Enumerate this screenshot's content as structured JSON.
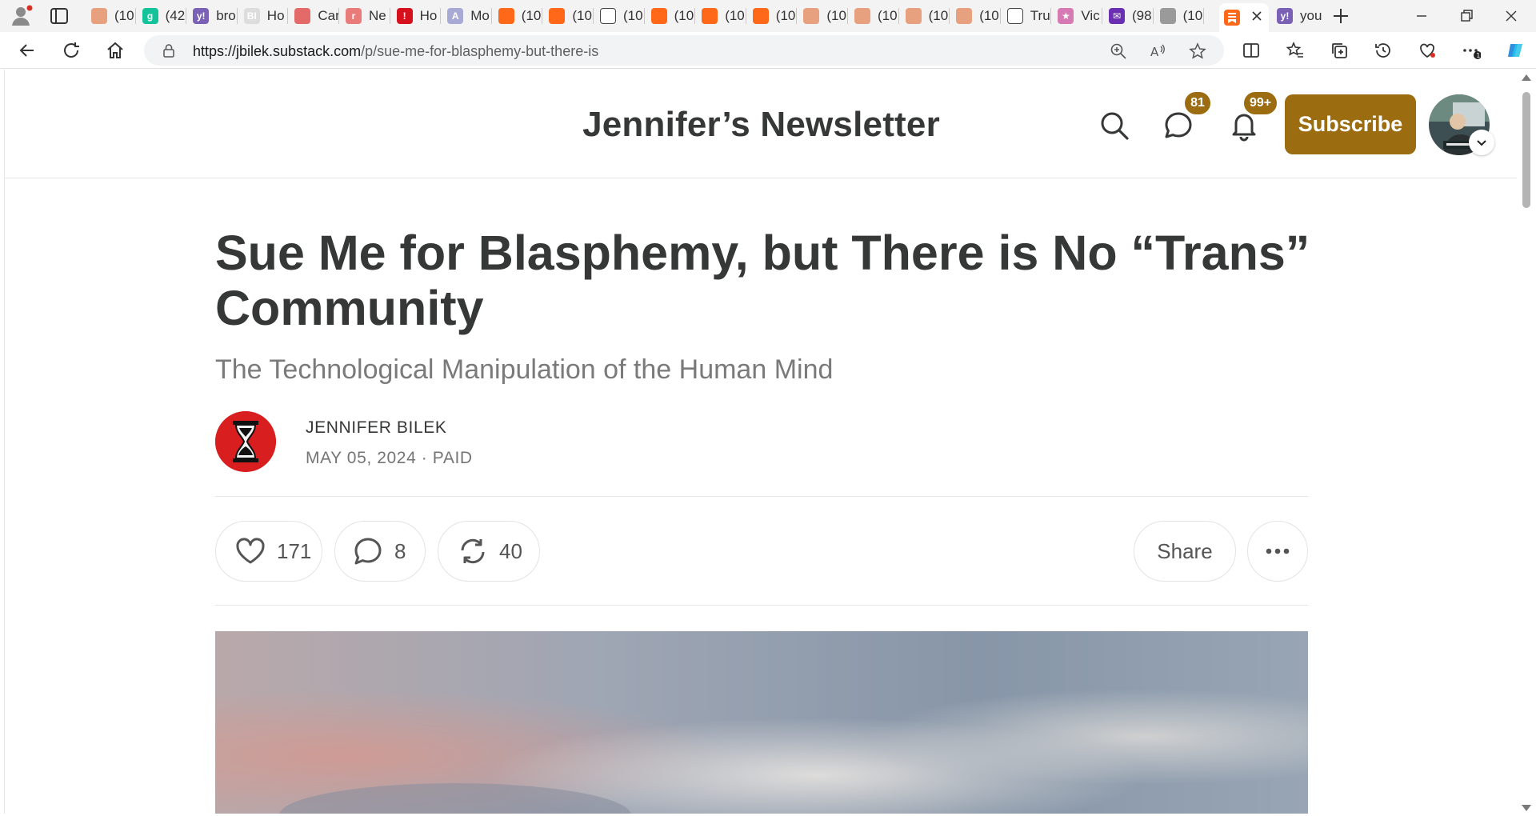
{
  "browser": {
    "tabs": [
      {
        "label": "(10",
        "color": "#e8a17f",
        "glyph": ""
      },
      {
        "label": "(42",
        "color": "#15c39a",
        "glyph": "g"
      },
      {
        "label": "bro",
        "color": "#7b61b6",
        "glyph": "y!"
      },
      {
        "label": "Ho",
        "color": "#dddddd",
        "glyph": "BI"
      },
      {
        "label": "Car",
        "color": "#e46a6a",
        "glyph": ""
      },
      {
        "label": "Ne",
        "color": "#e97b7b",
        "glyph": "r"
      },
      {
        "label": "Ho",
        "color": "#d6101d",
        "glyph": "!"
      },
      {
        "label": "Mo",
        "color": "#a9a9d6",
        "glyph": "A"
      },
      {
        "label": "(10",
        "color": "#ff6719",
        "glyph": ""
      },
      {
        "label": "(10",
        "color": "#ff6719",
        "glyph": ""
      },
      {
        "label": "(10",
        "color": "#ffffff",
        "glyph": ""
      },
      {
        "label": "(10",
        "color": "#ff6719",
        "glyph": ""
      },
      {
        "label": "(10",
        "color": "#ff6719",
        "glyph": ""
      },
      {
        "label": "(10",
        "color": "#ff6719",
        "glyph": ""
      },
      {
        "label": "(10",
        "color": "#e8a17f",
        "glyph": ""
      },
      {
        "label": "(10",
        "color": "#e8a17f",
        "glyph": ""
      },
      {
        "label": "(10",
        "color": "#e8a17f",
        "glyph": ""
      },
      {
        "label": "(10",
        "color": "#e8a17f",
        "glyph": ""
      },
      {
        "label": "Tru",
        "color": "#ffffff",
        "glyph": ""
      },
      {
        "label": "Vic",
        "color": "#d77ab3",
        "glyph": "★"
      },
      {
        "label": "(98",
        "color": "#6b2fb3",
        "glyph": "✉"
      },
      {
        "label": "(10",
        "color": "#9a9a9a",
        "glyph": ""
      }
    ],
    "active_tab": {
      "label": "",
      "color": "#ff6719"
    },
    "last_tab": {
      "label": "you",
      "color": "#7b61b6",
      "glyph": "y!"
    },
    "url_host": "https://jbilek.substack.com",
    "url_path": "/p/sue-me-for-blasphemy-but-there-is",
    "toolbar_badge": "1"
  },
  "site": {
    "publication_name": "Jennifer’s Newsletter",
    "chat_badge": "81",
    "notifications_badge": "99+",
    "subscribe_label": "Subscribe",
    "accent_color": "#9b6d10"
  },
  "post": {
    "title": "Sue Me for Blasphemy, but There is No “Trans” Community",
    "subtitle": "The Technological Manipulation of the Human Mind",
    "author": "JENNIFER BILEK",
    "meta": "MAY 05, 2024 · PAID",
    "likes": "171",
    "comments": "8",
    "restacks": "40",
    "share_label": "Share"
  }
}
